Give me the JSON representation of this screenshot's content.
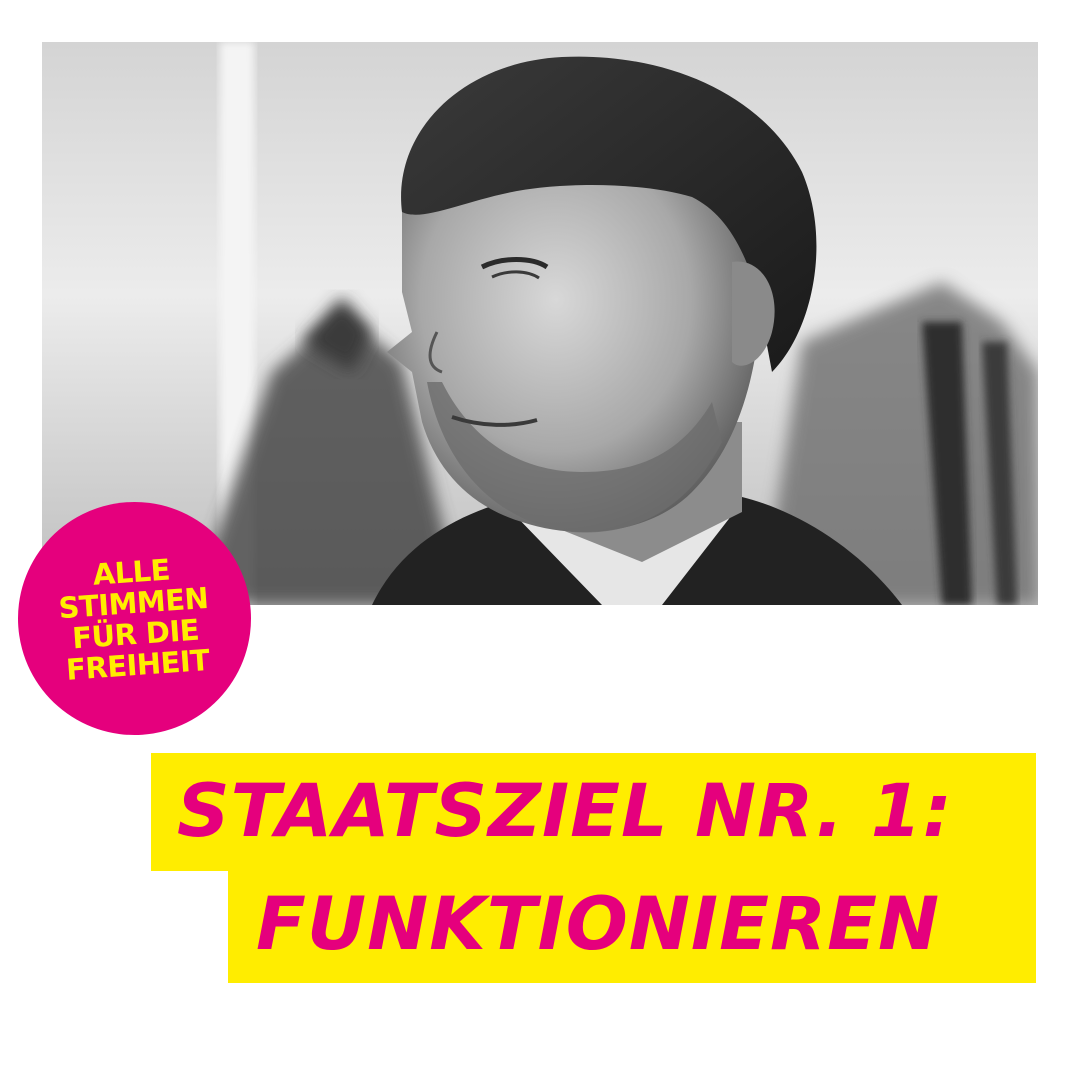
{
  "badge": {
    "lines": [
      "ALLE",
      "STIMMEN",
      "FÜR DIE",
      "FREIHEIT"
    ]
  },
  "headline": {
    "line1": "STAATSZIEL NR. 1:",
    "line2": "FUNKTIONIEREN"
  },
  "colors": {
    "magenta": "#e5007d",
    "yellow": "#ffed00",
    "background": "#ffffff"
  }
}
